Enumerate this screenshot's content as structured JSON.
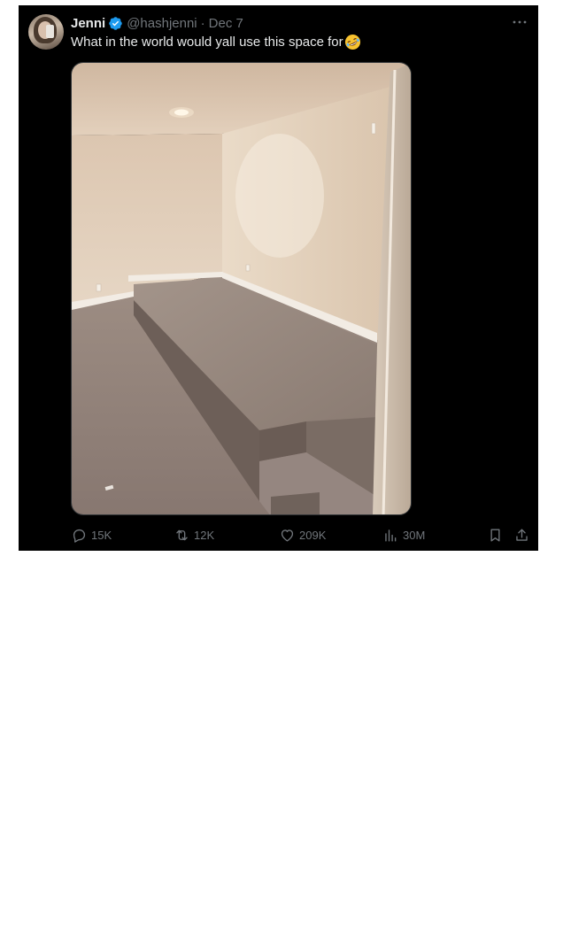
{
  "tweet": {
    "author_name": "Jenni",
    "handle": "@hashjenni",
    "separator": "·",
    "date": "Dec 7",
    "text": "What in the world would yall use this space for",
    "emoji": "rolling-on-floor-laughing-emoji",
    "image_description_icon": "photo-attachment",
    "stats": {
      "replies": "15K",
      "retweets": "12K",
      "likes": "209K",
      "views": "30M"
    }
  },
  "colors": {
    "background": "#000000",
    "primary_text": "#e7e9ea",
    "secondary_text": "#71767b",
    "verified": "#1d9bf0"
  },
  "icons": {
    "verified": "verified-badge-icon",
    "more": "more-options-icon",
    "reply": "reply-icon",
    "retweet": "retweet-icon",
    "like": "heart-icon",
    "views": "views-chart-icon",
    "bookmark": "bookmark-icon",
    "share": "share-icon"
  }
}
